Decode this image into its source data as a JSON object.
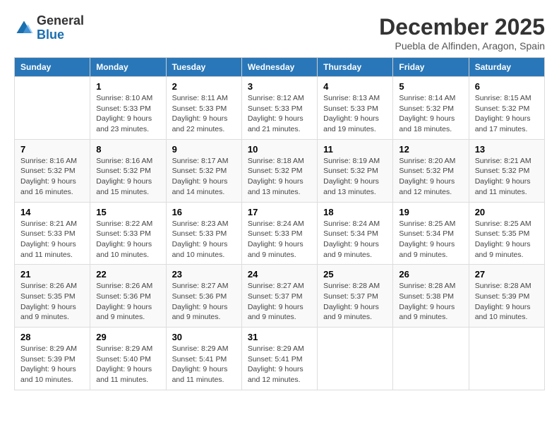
{
  "header": {
    "logo_general": "General",
    "logo_blue": "Blue",
    "month_title": "December 2025",
    "subtitle": "Puebla de Alfinden, Aragon, Spain"
  },
  "columns": [
    "Sunday",
    "Monday",
    "Tuesday",
    "Wednesday",
    "Thursday",
    "Friday",
    "Saturday"
  ],
  "weeks": [
    [
      {
        "day": "",
        "detail": ""
      },
      {
        "day": "1",
        "detail": "Sunrise: 8:10 AM\nSunset: 5:33 PM\nDaylight: 9 hours\nand 23 minutes."
      },
      {
        "day": "2",
        "detail": "Sunrise: 8:11 AM\nSunset: 5:33 PM\nDaylight: 9 hours\nand 22 minutes."
      },
      {
        "day": "3",
        "detail": "Sunrise: 8:12 AM\nSunset: 5:33 PM\nDaylight: 9 hours\nand 21 minutes."
      },
      {
        "day": "4",
        "detail": "Sunrise: 8:13 AM\nSunset: 5:33 PM\nDaylight: 9 hours\nand 19 minutes."
      },
      {
        "day": "5",
        "detail": "Sunrise: 8:14 AM\nSunset: 5:32 PM\nDaylight: 9 hours\nand 18 minutes."
      },
      {
        "day": "6",
        "detail": "Sunrise: 8:15 AM\nSunset: 5:32 PM\nDaylight: 9 hours\nand 17 minutes."
      }
    ],
    [
      {
        "day": "7",
        "detail": "Sunrise: 8:16 AM\nSunset: 5:32 PM\nDaylight: 9 hours\nand 16 minutes."
      },
      {
        "day": "8",
        "detail": "Sunrise: 8:16 AM\nSunset: 5:32 PM\nDaylight: 9 hours\nand 15 minutes."
      },
      {
        "day": "9",
        "detail": "Sunrise: 8:17 AM\nSunset: 5:32 PM\nDaylight: 9 hours\nand 14 minutes."
      },
      {
        "day": "10",
        "detail": "Sunrise: 8:18 AM\nSunset: 5:32 PM\nDaylight: 9 hours\nand 13 minutes."
      },
      {
        "day": "11",
        "detail": "Sunrise: 8:19 AM\nSunset: 5:32 PM\nDaylight: 9 hours\nand 13 minutes."
      },
      {
        "day": "12",
        "detail": "Sunrise: 8:20 AM\nSunset: 5:32 PM\nDaylight: 9 hours\nand 12 minutes."
      },
      {
        "day": "13",
        "detail": "Sunrise: 8:21 AM\nSunset: 5:32 PM\nDaylight: 9 hours\nand 11 minutes."
      }
    ],
    [
      {
        "day": "14",
        "detail": "Sunrise: 8:21 AM\nSunset: 5:33 PM\nDaylight: 9 hours\nand 11 minutes."
      },
      {
        "day": "15",
        "detail": "Sunrise: 8:22 AM\nSunset: 5:33 PM\nDaylight: 9 hours\nand 10 minutes."
      },
      {
        "day": "16",
        "detail": "Sunrise: 8:23 AM\nSunset: 5:33 PM\nDaylight: 9 hours\nand 10 minutes."
      },
      {
        "day": "17",
        "detail": "Sunrise: 8:24 AM\nSunset: 5:33 PM\nDaylight: 9 hours\nand 9 minutes."
      },
      {
        "day": "18",
        "detail": "Sunrise: 8:24 AM\nSunset: 5:34 PM\nDaylight: 9 hours\nand 9 minutes."
      },
      {
        "day": "19",
        "detail": "Sunrise: 8:25 AM\nSunset: 5:34 PM\nDaylight: 9 hours\nand 9 minutes."
      },
      {
        "day": "20",
        "detail": "Sunrise: 8:25 AM\nSunset: 5:35 PM\nDaylight: 9 hours\nand 9 minutes."
      }
    ],
    [
      {
        "day": "21",
        "detail": "Sunrise: 8:26 AM\nSunset: 5:35 PM\nDaylight: 9 hours\nand 9 minutes."
      },
      {
        "day": "22",
        "detail": "Sunrise: 8:26 AM\nSunset: 5:36 PM\nDaylight: 9 hours\nand 9 minutes."
      },
      {
        "day": "23",
        "detail": "Sunrise: 8:27 AM\nSunset: 5:36 PM\nDaylight: 9 hours\nand 9 minutes."
      },
      {
        "day": "24",
        "detail": "Sunrise: 8:27 AM\nSunset: 5:37 PM\nDaylight: 9 hours\nand 9 minutes."
      },
      {
        "day": "25",
        "detail": "Sunrise: 8:28 AM\nSunset: 5:37 PM\nDaylight: 9 hours\nand 9 minutes."
      },
      {
        "day": "26",
        "detail": "Sunrise: 8:28 AM\nSunset: 5:38 PM\nDaylight: 9 hours\nand 9 minutes."
      },
      {
        "day": "27",
        "detail": "Sunrise: 8:28 AM\nSunset: 5:39 PM\nDaylight: 9 hours\nand 10 minutes."
      }
    ],
    [
      {
        "day": "28",
        "detail": "Sunrise: 8:29 AM\nSunset: 5:39 PM\nDaylight: 9 hours\nand 10 minutes."
      },
      {
        "day": "29",
        "detail": "Sunrise: 8:29 AM\nSunset: 5:40 PM\nDaylight: 9 hours\nand 11 minutes."
      },
      {
        "day": "30",
        "detail": "Sunrise: 8:29 AM\nSunset: 5:41 PM\nDaylight: 9 hours\nand 11 minutes."
      },
      {
        "day": "31",
        "detail": "Sunrise: 8:29 AM\nSunset: 5:41 PM\nDaylight: 9 hours\nand 12 minutes."
      },
      {
        "day": "",
        "detail": ""
      },
      {
        "day": "",
        "detail": ""
      },
      {
        "day": "",
        "detail": ""
      }
    ]
  ]
}
